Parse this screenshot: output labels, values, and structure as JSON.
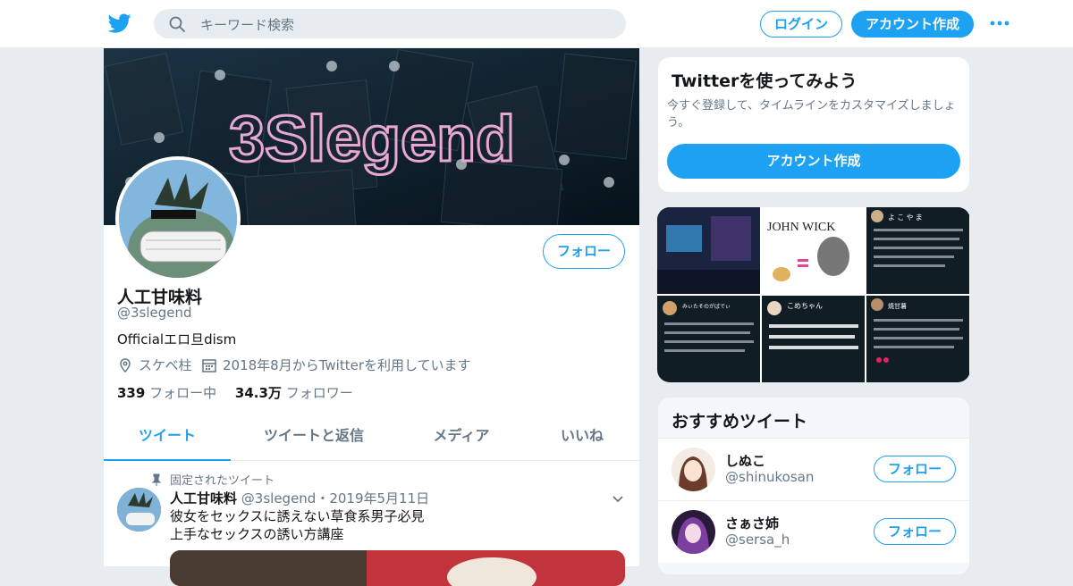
{
  "header": {
    "search_placeholder": "キーワード検索",
    "login_label": "ログイン",
    "signup_label": "アカウント作成",
    "more_icon": "more-icon",
    "brand_color": "#1da1f2"
  },
  "profile": {
    "banner_text": "3Slegend",
    "name": "人工甘味料",
    "handle": "@3slegend",
    "bio": "Officialエロ旦dism",
    "location": "スケベ柱",
    "joined": "2018年8月からTwitterを利用しています",
    "following_count": "339",
    "following_label": "フォロー中",
    "followers_count": "34.3万",
    "followers_label": "フォロワー",
    "follow_label": "フォロー"
  },
  "tabs": [
    {
      "label": "ツイート",
      "active": true
    },
    {
      "label": "ツイートと返信",
      "active": false
    },
    {
      "label": "メディア",
      "active": false
    },
    {
      "label": "いいね",
      "active": false
    }
  ],
  "pinned_tweet": {
    "pinned_label": "固定されたツイート",
    "author": "人工甘味料",
    "handle": "@3slegend",
    "date": "・2019年5月11日",
    "line1": "彼女をセックスに誘えない草食系男子必見",
    "line2": "上手なセックスの誘い方講座"
  },
  "sidebar": {
    "try_title": "Twitterを使ってみよう",
    "try_text": "今すぐ登録して、タイムラインをカスタマイズしましょう。",
    "try_button": "アカウント作成",
    "media_tiles": [
      {
        "text": ""
      },
      {
        "text": "JOHN WICK"
      },
      {
        "text": "よ こ や ま"
      },
      {
        "text": "みぃたそのがばでぃ"
      },
      {
        "text": "こめちゃん"
      },
      {
        "text": "焼甘薯"
      }
    ],
    "recommended_title": "おすすめツイート",
    "recommended": [
      {
        "name": "しぬこ",
        "handle": "@shinukosan",
        "follow": "フォロー"
      },
      {
        "name": "さぁさ姉",
        "handle": "@sersa_h",
        "follow": "フォロー"
      }
    ]
  }
}
